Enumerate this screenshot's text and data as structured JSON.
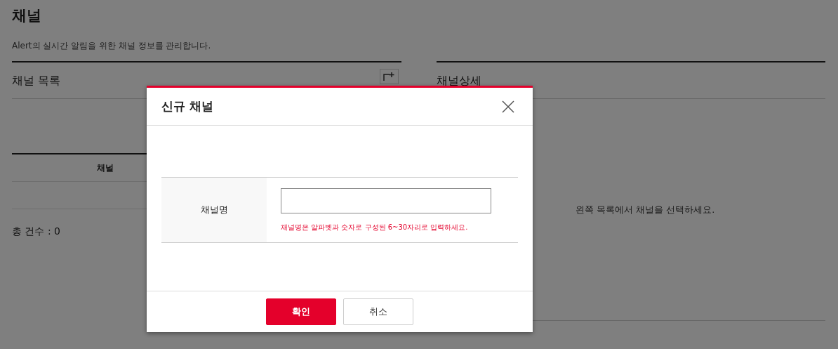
{
  "page": {
    "title": "채널",
    "description": "Alert의 실시간 알림을 위한 채널 정보를 관리합니다."
  },
  "list_panel": {
    "title": "채널 목록",
    "columns": [
      "채널"
    ],
    "total": "총 건수 : 0"
  },
  "detail_panel": {
    "title": "채널상세",
    "empty_message": "왼쪽 목록에서 채널을 선택하세요."
  },
  "dialog": {
    "title": "신규 채널",
    "field": {
      "label": "채널명",
      "hint": "채널명은 알파벳과 숫자로 구성된 6~30자리로 입력하세요."
    },
    "buttons": [
      {
        "label": "확인",
        "kind": "primary"
      },
      {
        "label": "취소",
        "kind": "secondary"
      }
    ]
  }
}
